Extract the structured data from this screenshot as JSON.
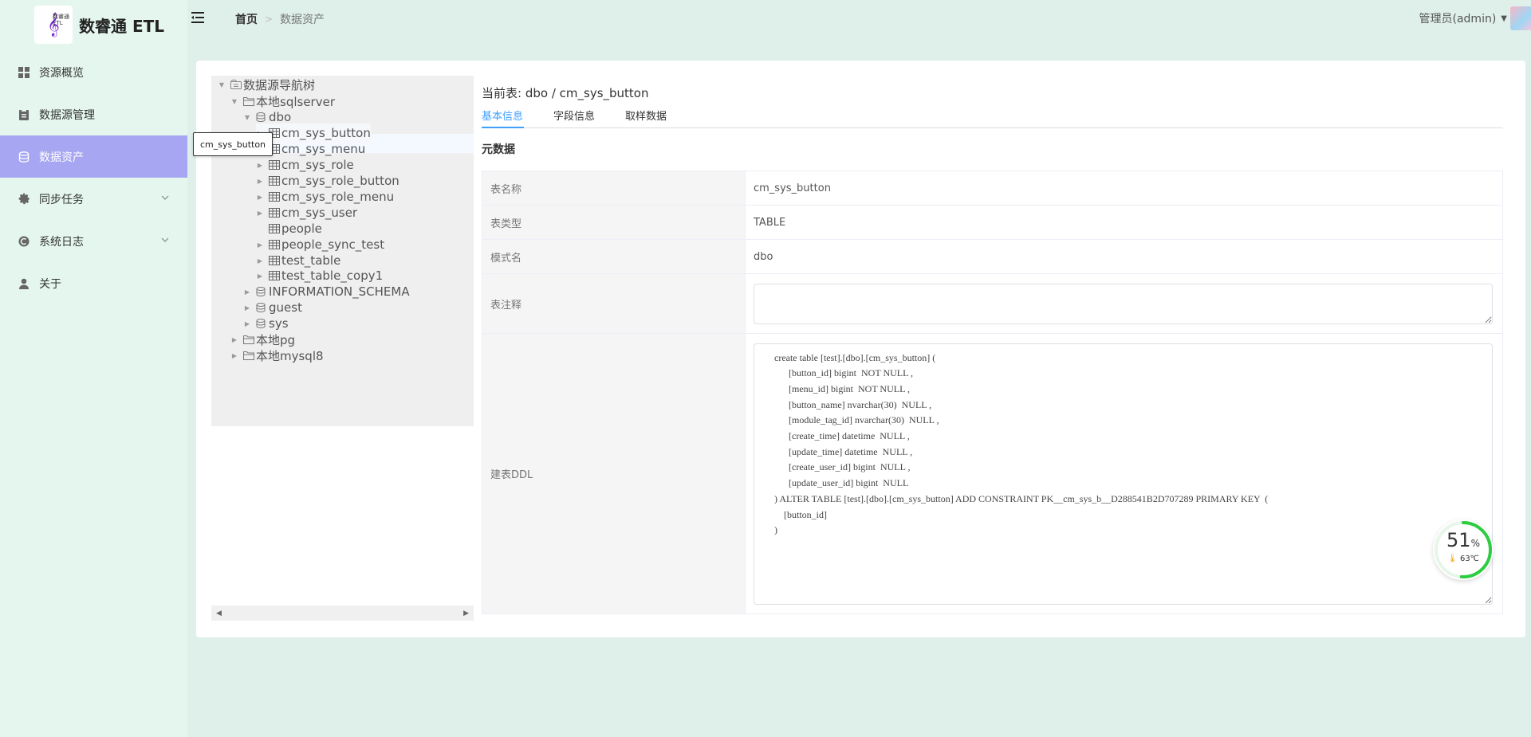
{
  "app": {
    "logo_text": "数睿通 ETL",
    "logo_mini_text": "数睿通\nETL"
  },
  "sidebar": {
    "items": [
      {
        "label": "资源概览",
        "icon": "grid-icon",
        "active": false,
        "has_children": false
      },
      {
        "label": "数据源管理",
        "icon": "clipboard-icon",
        "active": false,
        "has_children": false
      },
      {
        "label": "数据资产",
        "icon": "database-icon",
        "active": true,
        "has_children": false
      },
      {
        "label": "同步任务",
        "icon": "gear-icon",
        "active": false,
        "has_children": true
      },
      {
        "label": "系统日志",
        "icon": "log-icon",
        "active": false,
        "has_children": true
      },
      {
        "label": "关于",
        "icon": "user-icon",
        "active": false,
        "has_children": false
      }
    ]
  },
  "topbar": {
    "breadcrumb": {
      "home": "首页",
      "current": "数据资产"
    },
    "user": "管理员(admin)"
  },
  "tree": {
    "root": "数据源导航树",
    "nodes": [
      {
        "label": "数据源导航树",
        "level": 0,
        "icon": "tree-root-icon",
        "expanded": true
      },
      {
        "label": "本地sqlserver",
        "level": 1,
        "icon": "folder-icon",
        "expanded": true
      },
      {
        "label": "dbo",
        "level": 2,
        "icon": "schema-icon",
        "expanded": true
      },
      {
        "label": "cm_sys_button",
        "level": 3,
        "icon": "table-icon",
        "selected": true
      },
      {
        "label": "cm_sys_menu",
        "level": 3,
        "icon": "table-icon"
      },
      {
        "label": "cm_sys_role",
        "level": 3,
        "icon": "table-icon"
      },
      {
        "label": "cm_sys_role_button",
        "level": 3,
        "icon": "table-icon"
      },
      {
        "label": "cm_sys_role_menu",
        "level": 3,
        "icon": "table-icon"
      },
      {
        "label": "cm_sys_user",
        "level": 3,
        "icon": "table-icon"
      },
      {
        "label": "people",
        "level": 3,
        "icon": "table-icon",
        "leaf": true
      },
      {
        "label": "people_sync_test",
        "level": 3,
        "icon": "table-icon"
      },
      {
        "label": "test_table",
        "level": 3,
        "icon": "table-icon"
      },
      {
        "label": "test_table_copy1",
        "level": 3,
        "icon": "table-icon"
      },
      {
        "label": "INFORMATION_SCHEMA",
        "level": 2,
        "icon": "schema-icon"
      },
      {
        "label": "guest",
        "level": 2,
        "icon": "schema-icon"
      },
      {
        "label": "sys",
        "level": 2,
        "icon": "schema-icon"
      },
      {
        "label": "本地pg",
        "level": 1,
        "icon": "folder-icon"
      },
      {
        "label": "本地mysql8",
        "level": 1,
        "icon": "folder-icon"
      }
    ],
    "tooltip": "cm_sys_button"
  },
  "detail": {
    "current_prefix": "当前表:",
    "current_table": "dbo / cm_sys_button",
    "tabs": [
      {
        "label": "基本信息",
        "active": true
      },
      {
        "label": "字段信息",
        "active": false
      },
      {
        "label": "取样数据",
        "active": false
      }
    ],
    "meta_title": "元数据",
    "rows": {
      "table_name": {
        "label": "表名称",
        "value": "cm_sys_button"
      },
      "table_type": {
        "label": "表类型",
        "value": "TABLE"
      },
      "schema_name": {
        "label": "模式名",
        "value": "dbo"
      },
      "comment": {
        "label": "表注释",
        "value": ""
      },
      "ddl": {
        "label": "建表DDL",
        "value": "     create table [test].[dbo].[cm_sys_button] (\n           [button_id] bigint  NOT NULL ,\n           [menu_id] bigint  NOT NULL ,\n           [button_name] nvarchar(30)  NULL ,\n           [module_tag_id] nvarchar(30)  NULL ,\n           [create_time] datetime  NULL ,\n           [update_time] datetime  NULL ,\n           [create_user_id] bigint  NULL ,\n           [update_user_id] bigint  NULL\n     ) ALTER TABLE [test].[dbo].[cm_sys_button] ADD CONSTRAINT PK__cm_sys_b__D288541B2D707289 PRIMARY KEY  (\n         [button_id]\n     )"
      }
    }
  },
  "gauge": {
    "value": "51",
    "unit": "%",
    "fraction": 0.51,
    "temp": "63℃",
    "color": "#2ecc40"
  }
}
